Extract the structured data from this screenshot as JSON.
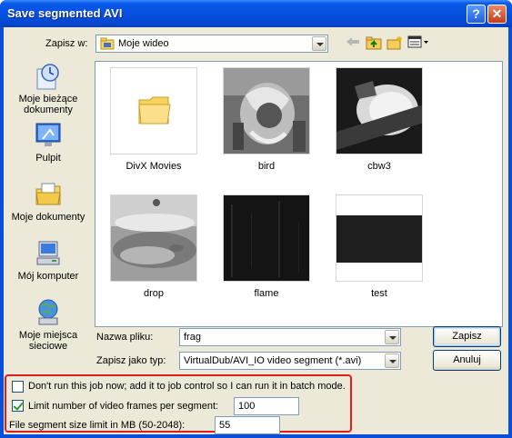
{
  "window": {
    "title": "Save segmented AVI",
    "help_label": "?",
    "close_label": "✕"
  },
  "lookin": {
    "label": "Zapisz w:",
    "value": "Moje wideo"
  },
  "places": [
    {
      "label": "Moje bieżące dokumenty",
      "icon": "recent-documents-icon"
    },
    {
      "label": "Pulpit",
      "icon": "desktop-icon"
    },
    {
      "label": "Moje dokumenty",
      "icon": "my-documents-icon"
    },
    {
      "label": "Mój komputer",
      "icon": "my-computer-icon"
    },
    {
      "label": "Moje miejsca sieciowe",
      "icon": "network-places-icon"
    }
  ],
  "files": [
    {
      "name": "DivX Movies",
      "type": "folder"
    },
    {
      "name": "bird",
      "type": "video"
    },
    {
      "name": "cbw3",
      "type": "video"
    },
    {
      "name": "drop",
      "type": "video"
    },
    {
      "name": "flame",
      "type": "video"
    },
    {
      "name": "test",
      "type": "video"
    }
  ],
  "filename": {
    "label": "Nazwa pliku:",
    "value": "frag"
  },
  "filetype": {
    "label": "Zapisz jako typ:",
    "value": "VirtualDub/AVI_IO video segment (*.avi)"
  },
  "buttons": {
    "save": "Zapisz",
    "cancel": "Anuluj"
  },
  "options": {
    "batch_label": "Don't run this job now; add it to job control so I can run it in batch mode.",
    "batch_checked": false,
    "limit_frames_label": "Limit number of video frames per segment:",
    "limit_frames_checked": true,
    "limit_frames_value": "100",
    "size_limit_label": "File segment size limit in MB (50-2048):",
    "size_limit_value": "55"
  },
  "colors": {
    "titlebar": "#0550e0",
    "highlight_box": "#e21b1b"
  }
}
